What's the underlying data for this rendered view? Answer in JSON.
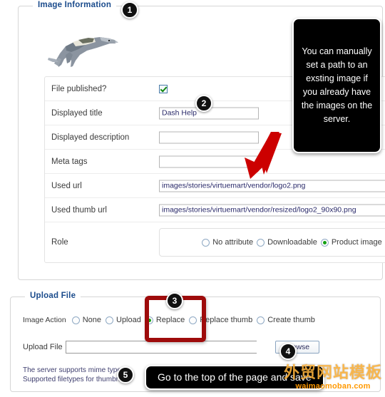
{
  "image_information": {
    "legend": "Image Information",
    "preview_alt": "running-greyhound-logo",
    "fields": {
      "file_published": {
        "label": "File published?",
        "checked": true
      },
      "displayed_title": {
        "label": "Displayed title",
        "value": "Dash Help",
        "placeholder": ""
      },
      "displayed_description": {
        "label": "Displayed description",
        "value": "",
        "placeholder": ""
      },
      "meta_tags": {
        "label": "Meta tags",
        "value": "",
        "placeholder": ""
      },
      "used_url": {
        "label": "Used url",
        "value": "images/stories/virtuemart/vendor/logo2.png",
        "placeholder": ""
      },
      "used_thumb_url": {
        "label": "Used thumb url",
        "value": "images/stories/virtuemart/vendor/resized/logo2_90x90.png",
        "placeholder": ""
      },
      "role": {
        "label": "Role",
        "options": [
          {
            "label": "No attribute",
            "selected": false
          },
          {
            "label": "Downloadable",
            "selected": false
          },
          {
            "label": "Product image",
            "selected": true
          }
        ]
      }
    }
  },
  "upload_file": {
    "legend": "Upload File",
    "image_action": {
      "label": "Image Action",
      "options": [
        {
          "label": "None",
          "selected": false
        },
        {
          "label": "Upload",
          "selected": false
        },
        {
          "label": "Replace",
          "selected": true
        },
        {
          "label": "Replace thumb",
          "selected": false
        },
        {
          "label": "Create thumb",
          "selected": false
        }
      ]
    },
    "upload_input": {
      "label": "Upload File",
      "value": "",
      "placeholder": "",
      "browse_label": "Browse"
    },
    "notes": [
      "The server supports mime type re",
      "Supported filetypes for thumbnail"
    ]
  },
  "annotations": {
    "badges": [
      {
        "id": "1",
        "number": "1"
      },
      {
        "id": "2",
        "number": "2"
      },
      {
        "id": "3",
        "number": "3"
      },
      {
        "id": "4",
        "number": "4"
      },
      {
        "id": "5",
        "number": "5"
      }
    ],
    "callout": "You can manually set a path to an exsting image if you already have the images on the server.",
    "tooltip": "Go to the top of the page and save",
    "arrow_color": "#cc0000",
    "highlight_box_color": "#9e0b0b"
  },
  "watermark": {
    "chinese": "外贸网站模板",
    "domain": "waimaomoban.com"
  }
}
